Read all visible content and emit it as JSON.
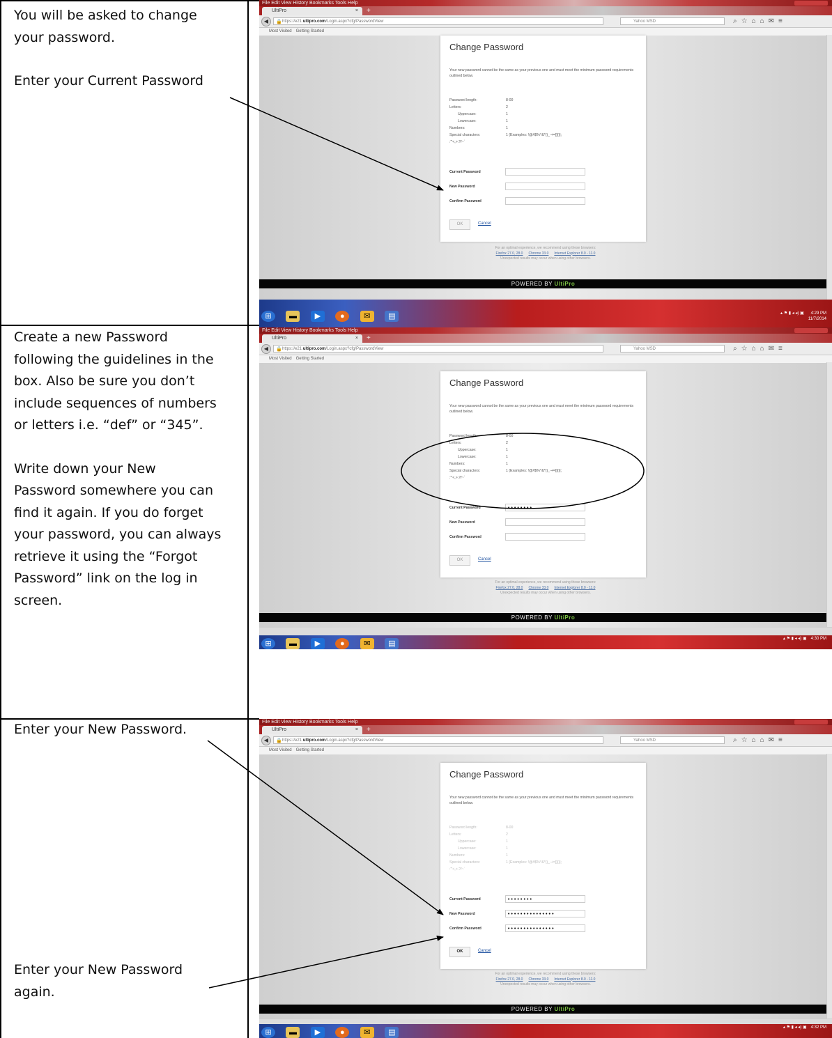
{
  "instructions": {
    "step1": {
      "line1": "You will be asked to change",
      "line2": "your password.",
      "line3": "Enter your Current Password"
    },
    "step2": {
      "lines": [
        "Create a new Password",
        "following the guidelines in the",
        "box. Also be sure you don’t",
        "include sequences of numbers",
        "or letters i.e. “def” or “345”.",
        "",
        "Write down your New",
        "Password somewhere you can",
        "find it again.  If you do forget",
        "your password, you can always",
        "retrieve it using the “Forgot",
        "Password” link on the log in",
        "screen."
      ]
    },
    "step3": {
      "line1": "Enter your New Password.",
      "line2a": "Enter your New Password",
      "line2b": "again."
    }
  },
  "browser": {
    "menu": "File  Edit  View  History  Bookmarks  Tools  Help",
    "tab_label": "UltiPro",
    "url_prefix": "https://e21.",
    "url_domain": "ultipro.com",
    "url_path": "/Login.aspx?cfg/PasswordView",
    "search_placeholder": "Yahoo MSD",
    "bookmark_1": "Most Visited",
    "bookmark_2": "Getting Started"
  },
  "page": {
    "title": "Change Password",
    "description": "Your new password cannot be the same as your previous one and must meet the minimum password requirements outlined below.",
    "requirements": {
      "length_label": "Password length:",
      "length_value": "8-00",
      "letters_label": "Letters:",
      "letters_value": "2",
      "upper_label": "Uppercase:",
      "upper_value": "1",
      "lower_label": "Lowercase:",
      "lower_value": "1",
      "numbers_label": "Numbers:",
      "numbers_value": "1",
      "special_label": "Special characters:",
      "special_value": "1 (Examples: !@#$%^&*()_-+=[]{}|;",
      "special_value2": ":\"'<,>.?/~`"
    },
    "labels": {
      "current": "Current Password",
      "new": "New Password",
      "confirm": "Confirm Password"
    },
    "values": {
      "shot2_current": "••••••••",
      "shot3_current": "••••••••",
      "shot3_new": "•••••••••••••••",
      "shot3_confirm": "•••••••••••••••"
    },
    "ok_label": "OK",
    "cancel_label": "Cancel",
    "footer_line1": "For an optimal experience, we recommend using these browsers:",
    "footer_link1": "Firefox 27.0, 28.0",
    "footer_link2": "Chrome 33.0",
    "footer_link3": "Internet Explorer 8.0 - 11.0",
    "footer_line3": "Unexpected results may occur when using other browsers.",
    "powered_by": "POWERED BY",
    "brand": "UltiPro"
  },
  "taskbar": {
    "shot1_time": "4:29 PM",
    "shot1_date": "11/7/2014",
    "shot2_time": "4:30 PM",
    "shot3_time": "4:32 PM"
  },
  "icons": [
    "windows-start-icon",
    "folder-icon",
    "media-player-icon",
    "firefox-icon",
    "mail-icon",
    "document-icon"
  ]
}
